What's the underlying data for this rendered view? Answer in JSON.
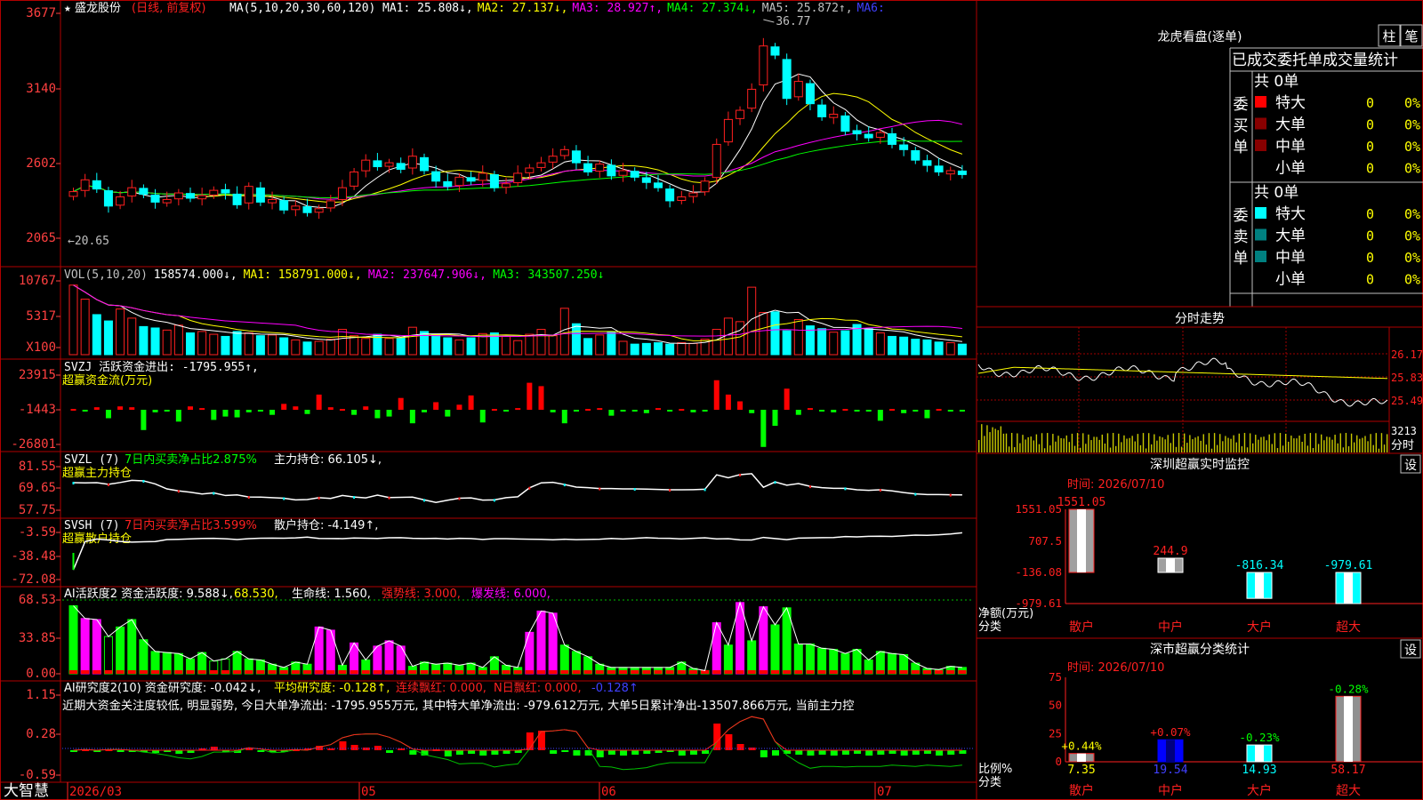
{
  "title_bar": {
    "stock_name": "盛龙股份",
    "period": "(日线, 前复权)",
    "ma_label": "MA(5,10,20,30,60,120)",
    "ma_values": [
      {
        "text": "MA1: 25.808↓,",
        "color": "#ffffff"
      },
      {
        "text": "MA2: 27.137↓,",
        "color": "#ffff00"
      },
      {
        "text": "MA3: 28.927↑,",
        "color": "#ff00ff"
      },
      {
        "text": "MA4: 27.374↓,",
        "color": "#00ff00"
      },
      {
        "text": "MA5: 25.872↑,",
        "color": "#c0c0c0"
      },
      {
        "text": "MA6:",
        "color": "#4040ff"
      }
    ]
  },
  "price_axis": {
    "labels": [
      "3677",
      "3140",
      "2602",
      "2065"
    ]
  },
  "price_annotations": {
    "high": "36.77",
    "low": "←20.65"
  },
  "vol_panel": {
    "axis": [
      "10767",
      "5317",
      "X100"
    ],
    "header": [
      {
        "text": "VOL(5,10,20)",
        "color": "#c0c0c0"
      },
      {
        "text": "158574.000↓,",
        "color": "#ffffff"
      },
      {
        "text": "MA1: 158791.000↓,",
        "color": "#ffff00"
      },
      {
        "text": "MA2: 237647.906↓,",
        "color": "#ff00ff"
      },
      {
        "text": "MA3: 343507.250↓",
        "color": "#00ff00"
      }
    ]
  },
  "svzj_panel": {
    "axis": [
      "23915",
      "-1443",
      "-26801"
    ],
    "header": "SVZJ  活跃资金进出: -1795.955↑,",
    "subtitle": "超赢资金流(万元)"
  },
  "svzl_panel": {
    "axis": [
      "81.55",
      "69.65",
      "57.75"
    ],
    "header_name": "SVZL (7)",
    "header_ratio": "7日内买卖净占比2.875%",
    "header_hold": "主力持仓: 66.105↓,",
    "subtitle": "超赢主力持仓"
  },
  "svsh_panel": {
    "axis": [
      "-3.59",
      "-38.48",
      "-72.08"
    ],
    "header_name": "SVSH (7)",
    "header_ratio": "7日内买卖净占比3.599%",
    "header_hold": "散户持仓: -4.149↑,",
    "subtitle": "超赢散户持仓"
  },
  "ai1_panel": {
    "axis": [
      "68.53",
      "33.85",
      "0.00"
    ],
    "header": [
      {
        "text": "AI活跃度2 资金活跃度: 9.588↓,",
        "color": "#ffffff"
      },
      {
        "text": "68.530,",
        "color": "#ffff00"
      },
      {
        "text": "生命线: 1.560,",
        "color": "#ffffff"
      },
      {
        "text": "强势线: 3.000,",
        "color": "#ff2020"
      },
      {
        "text": "爆发线: 6.000,",
        "color": "#ff00ff"
      }
    ]
  },
  "ai2_panel": {
    "axis": [
      "1.15",
      "0.28",
      "-0.59"
    ],
    "header": [
      {
        "text": "AI研究度2(10) 资金研究度: -0.042↓,",
        "color": "#ffffff"
      },
      {
        "text": "平均研究度: -0.128↑,",
        "color": "#ffff00"
      },
      {
        "text": "连续飘红: 0.000,",
        "color": "#ff2020"
      },
      {
        "text": "N日飘红: 0.000,",
        "color": "#ff2020"
      },
      {
        "text": "-0.128↑",
        "color": "#4040ff"
      }
    ],
    "comment": "近期大资金关注度较低, 明显弱势, 今日大单净流出: -1795.955万元, 其中特大单净流出: -979.612万元, 大单5日累计净出-13507.866万元, 当前主力控"
  },
  "date_axis": {
    "brand": "大智慧",
    "labels": [
      "2026/03",
      "05",
      "06",
      "07"
    ]
  },
  "longhu": {
    "title": "龙虎看盘(逐单)",
    "btn_zhu": "柱",
    "btn_bi": "笔",
    "table_title": "已成交委托单成交量统计",
    "buy_label": "委买单",
    "sell_label": "委卖单",
    "buy_total": "共 0单",
    "sell_total": "共 0单",
    "buy_rows": [
      {
        "label": "特大",
        "count": "0",
        "pct": "0%",
        "color": "#ff0000"
      },
      {
        "label": "大单",
        "count": "0",
        "pct": "0%",
        "color": "#880000"
      },
      {
        "label": "中单",
        "count": "0",
        "pct": "0%",
        "color": "#880000"
      },
      {
        "label": "小单",
        "count": "0",
        "pct": "0%",
        "color": ""
      }
    ],
    "sell_rows": [
      {
        "label": "特大",
        "count": "0",
        "pct": "0%",
        "color": "#00ffff"
      },
      {
        "label": "大单",
        "count": "0",
        "pct": "0%",
        "color": "#008080"
      },
      {
        "label": "中单",
        "count": "0",
        "pct": "0%",
        "color": "#008080"
      },
      {
        "label": "小单",
        "count": "0",
        "pct": "0%",
        "color": ""
      }
    ]
  },
  "intraday": {
    "title": "分时走势",
    "price_labels": [
      "26.17",
      "25.83",
      "25.49"
    ],
    "vol_label": "3213",
    "vol_unit": "分时"
  },
  "sz_monitor": {
    "title": "深圳超赢实时监控",
    "set_btn": "设",
    "time": "时间: 2026/07/10",
    "axis": [
      "1551.05",
      "707.5",
      "-136.08",
      "-979.61"
    ],
    "axis_caption_1": "净额(万元)",
    "axis_caption_2": "分类",
    "bars": [
      {
        "label": "散户",
        "value": 1551.05,
        "text": "1551.05"
      },
      {
        "label": "中户",
        "value": 244.9,
        "text": "244.9"
      },
      {
        "label": "大户",
        "value": -816.34,
        "text": "-816.34"
      },
      {
        "label": "超大",
        "value": -979.61,
        "text": "-979.61"
      }
    ]
  },
  "sz_stats": {
    "title": "深市超赢分类统计",
    "set_btn": "设",
    "time": "时间: 2026/07/10",
    "axis": [
      "75",
      "50",
      "25",
      "0"
    ],
    "axis_caption_1": "比例%",
    "axis_caption_2": "分类",
    "bars": [
      {
        "label": "散户",
        "value": 7.35,
        "text": "7.35",
        "delta": "+0.44%"
      },
      {
        "label": "中户",
        "value": 19.54,
        "text": "19.54",
        "delta": "+0.07%"
      },
      {
        "label": "大户",
        "value": 14.93,
        "text": "14.93",
        "delta": "-0.23%"
      },
      {
        "label": "超大",
        "value": 58.17,
        "text": "58.17",
        "delta": "-0.28%"
      }
    ]
  },
  "chart_data": [
    {
      "type": "candlestick",
      "xlabel": "",
      "ylabel": "",
      "ylim": [
        20.65,
        36.77
      ],
      "y_tick_labels": [
        "3677",
        "3140",
        "2602",
        "2065"
      ],
      "x_tick_labels": [
        "2026/03",
        "05",
        "06",
        "07"
      ],
      "annotations": [
        "36.77",
        "←20.65"
      ],
      "close": [
        24.2,
        25.1,
        24.4,
        23.1,
        23.8,
        24.5,
        24.0,
        23.4,
        23.6,
        24.1,
        23.7,
        23.9,
        24.3,
        24.1,
        23.2,
        24.6,
        23.4,
        23.6,
        22.8,
        23.1,
        22.6,
        22.9,
        23.5,
        24.5,
        25.7,
        26.6,
        26.1,
        26.4,
        25.9,
        26.9,
        25.8,
        25.0,
        24.6,
        25.3,
        25.0,
        25.6,
        24.5,
        24.8,
        25.6,
        26.0,
        26.4,
        26.9,
        27.4,
        26.4,
        25.7,
        26.3,
        25.4,
        25.8,
        25.3,
        24.9,
        24.5,
        23.5,
        23.8,
        24.1,
        25.0,
        27.8,
        29.7,
        30.4,
        32.0,
        35.3,
        34.6,
        31.3,
        32.6,
        30.9,
        29.9,
        30.1,
        28.8,
        28.6,
        28.3,
        28.7,
        27.8,
        27.4,
        26.6,
        26.2,
        25.7,
        25.8,
        25.5
      ]
    },
    {
      "type": "bar",
      "name": "VOL",
      "y_tick_labels": [
        "10767",
        "5317",
        "X100"
      ],
      "values": [
        99,
        79,
        57,
        48,
        65,
        52,
        40,
        38,
        35,
        42,
        31,
        33,
        29,
        26,
        33,
        31,
        27,
        28,
        24,
        21,
        18,
        19,
        22,
        36,
        27,
        23,
        29,
        23,
        24,
        39,
        33,
        29,
        24,
        21,
        24,
        30,
        31,
        26,
        20,
        29,
        36,
        27,
        66,
        44,
        23,
        28,
        32,
        19,
        15,
        16,
        17,
        15,
        17,
        16,
        22,
        36,
        52,
        47,
        96,
        60,
        61,
        34,
        50,
        41,
        37,
        32,
        34,
        43,
        37,
        31,
        26,
        25,
        22,
        21,
        18,
        17,
        15
      ]
    },
    {
      "type": "bar",
      "name": "超赢资金流(万元)",
      "y_tick_labels": [
        "23915",
        "-1443",
        "-26801"
      ],
      "values": [
        1,
        -2,
        3,
        -10,
        4,
        3,
        -24,
        -3,
        -1,
        -14,
        4,
        2,
        -12,
        -8,
        -9,
        -3,
        -2,
        -6,
        7,
        4,
        -5,
        18,
        3,
        1,
        -6,
        4,
        -10,
        -8,
        14,
        -16,
        -3,
        9,
        -8,
        6,
        17,
        -15,
        1,
        -1,
        2,
        32,
        28,
        -3,
        -16,
        -1,
        1,
        2,
        -7,
        -1,
        -2,
        -4,
        2,
        -2,
        1,
        -3,
        -2,
        35,
        18,
        10,
        -4,
        -44,
        -19,
        25,
        -6,
        2,
        -1,
        -3,
        1,
        -2,
        -1,
        -13,
        1,
        -4,
        -1,
        -10,
        1,
        -2,
        0
      ]
    },
    {
      "type": "line",
      "name": "超赢主力持仓",
      "y_tick_labels": [
        "81.55",
        "69.65",
        "57.75"
      ],
      "values": [
        72.8,
        72.7,
        72.8,
        71.9,
        72.9,
        74.1,
        73.8,
        72.1,
        69.4,
        68.3,
        67.6,
        66.6,
        67.2,
        65.8,
        66.1,
        65.0,
        64.9,
        64.6,
        64.3,
        63.4,
        63.6,
        64.6,
        64.2,
        65.8,
        65.0,
        64.5,
        66.0,
        64.7,
        64.8,
        64.9,
        63.4,
        62.0,
        63.2,
        64.3,
        64.5,
        63.3,
        63.4,
        64.6,
        65.1,
        70.0,
        72.7,
        73.0,
        71.8,
        70.4,
        70.1,
        69.6,
        69.6,
        69.4,
        69.4,
        69.3,
        69.1,
        68.9,
        68.9,
        69.0,
        69.2,
        77.1,
        75.5,
        77.2,
        77.7,
        70.3,
        73.2,
        71.4,
        72.3,
        70.8,
        70.1,
        69.7,
        69.7,
        68.9,
        68.6,
        68.9,
        68.3,
        67.4,
        66.7,
        66.3,
        66.3,
        66.2,
        66.1
      ]
    },
    {
      "type": "line",
      "name": "超赢散户持仓",
      "y_tick_labels": [
        "-3.59",
        "-38.48",
        "-72.08"
      ],
      "values": [
        -58.0,
        -16.9,
        -13.2,
        -14.5,
        -16.6,
        -17.7,
        -17.2,
        -16.9,
        -14.0,
        -13.6,
        -13.0,
        -12.3,
        -12.1,
        -12.8,
        -13.9,
        -12.7,
        -12.0,
        -11.8,
        -12.0,
        -11.5,
        -10.4,
        -12.3,
        -12.4,
        -12.6,
        -11.6,
        -12.0,
        -12.3,
        -11.3,
        -11.2,
        -12.1,
        -12.5,
        -12.1,
        -13.1,
        -12.1,
        -12.5,
        -13.8,
        -12.7,
        -12.6,
        -13.1,
        -13.4,
        -13.6,
        -14.2,
        -13.5,
        -14.1,
        -13.8,
        -13.4,
        -12.3,
        -13.1,
        -12.1,
        -11.2,
        -12.0,
        -12.2,
        -13.0,
        -12.2,
        -11.3,
        -13.0,
        -12.6,
        -14.4,
        -14.5,
        -10.8,
        -12.4,
        -14.1,
        -11.9,
        -11.5,
        -11.2,
        -11.0,
        -9.6,
        -10.1,
        -9.3,
        -9.1,
        -9.4,
        -8.4,
        -7.5,
        -7.8,
        -7.0,
        -5.8,
        -4.1
      ]
    },
    {
      "type": "bar",
      "name": "资金活跃度",
      "y_tick_labels": [
        "68.53",
        "33.85",
        "0.00"
      ],
      "values": [
        64,
        52,
        51,
        35,
        44,
        51,
        32,
        21,
        20,
        19,
        14,
        20,
        12,
        14,
        21,
        14,
        13,
        9,
        6,
        11,
        9,
        44,
        41,
        8,
        29,
        13,
        26,
        31,
        26,
        7,
        11,
        9,
        10,
        8,
        10,
        6,
        16,
        8,
        6,
        39,
        59,
        57,
        27,
        21,
        16,
        9,
        6,
        6,
        6,
        6,
        6,
        6,
        11,
        5,
        3,
        48,
        27,
        67,
        31,
        63,
        46,
        62,
        28,
        28,
        24,
        23,
        19,
        23,
        13,
        21,
        19,
        18,
        10,
        5,
        4,
        7,
        6
      ]
    },
    {
      "type": "bar",
      "name": "资金研究度",
      "y_tick_labels": [
        "1.15",
        "0.28",
        "-0.59"
      ],
      "values": [
        0.0,
        0.01,
        -0.01,
        0.01,
        0.0,
        -0.01,
        -0.02,
        -0.03,
        -0.02,
        -0.04,
        -0.03,
        0.02,
        0.04,
        -0.02,
        -0.03,
        0.03,
        0.0,
        -0.02,
        -0.01,
        0.01,
        0.02,
        0.05,
        0.02,
        0.1,
        0.06,
        0.03,
        0.05,
        -0.03,
        0.02,
        -0.05,
        -0.06,
        0.01,
        -0.07,
        -0.05,
        -0.04,
        -0.06,
        -0.05,
        -0.04,
        -0.03,
        0.2,
        0.22,
        -0.04,
        -0.02,
        -0.06,
        -0.06,
        -0.08,
        -0.05,
        -0.06,
        -0.05,
        -0.04,
        -0.03,
        -0.02,
        -0.06,
        -0.05,
        -0.04,
        0.3,
        0.18,
        0.07,
        0.03,
        -0.08,
        -0.06,
        -0.04,
        -0.05,
        -0.06,
        -0.05,
        -0.06,
        -0.05,
        -0.04,
        -0.06,
        -0.05,
        -0.04,
        -0.06,
        -0.05,
        -0.04,
        -0.06,
        -0.05,
        -0.04
      ]
    }
  ]
}
